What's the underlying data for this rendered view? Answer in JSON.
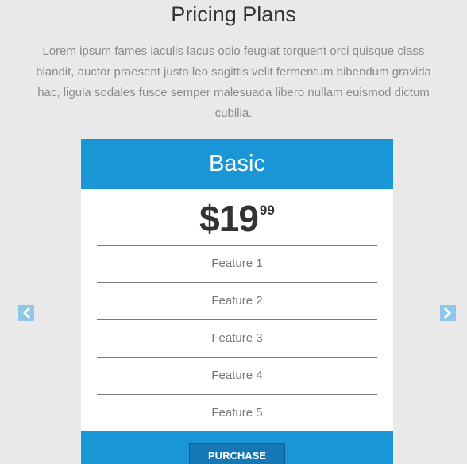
{
  "header": {
    "title": "Pricing Plans",
    "intro": "Lorem ipsum fames iaculis lacus odio feugiat torquent orci quisque class blandit, auctor praesent justo leo sagittis velit fermentum bibendum gravida hac, ligula sodales fusce semper malesuada libero nullam euismod dictum cubilia."
  },
  "plan": {
    "name": "Basic",
    "price_main": "$19",
    "price_cents": "99",
    "features": [
      "Feature 1",
      "Feature 2",
      "Feature 3",
      "Feature 4",
      "Feature 5"
    ],
    "button_label": "PURCHASE"
  },
  "carousel": {
    "prev_icon": "chevron-left-icon",
    "next_icon": "chevron-right-icon"
  },
  "colors": {
    "background": "#e9e9e9",
    "accent": "#1a96d6",
    "button": "#1677b5",
    "arrow": "#8ec7ea"
  }
}
